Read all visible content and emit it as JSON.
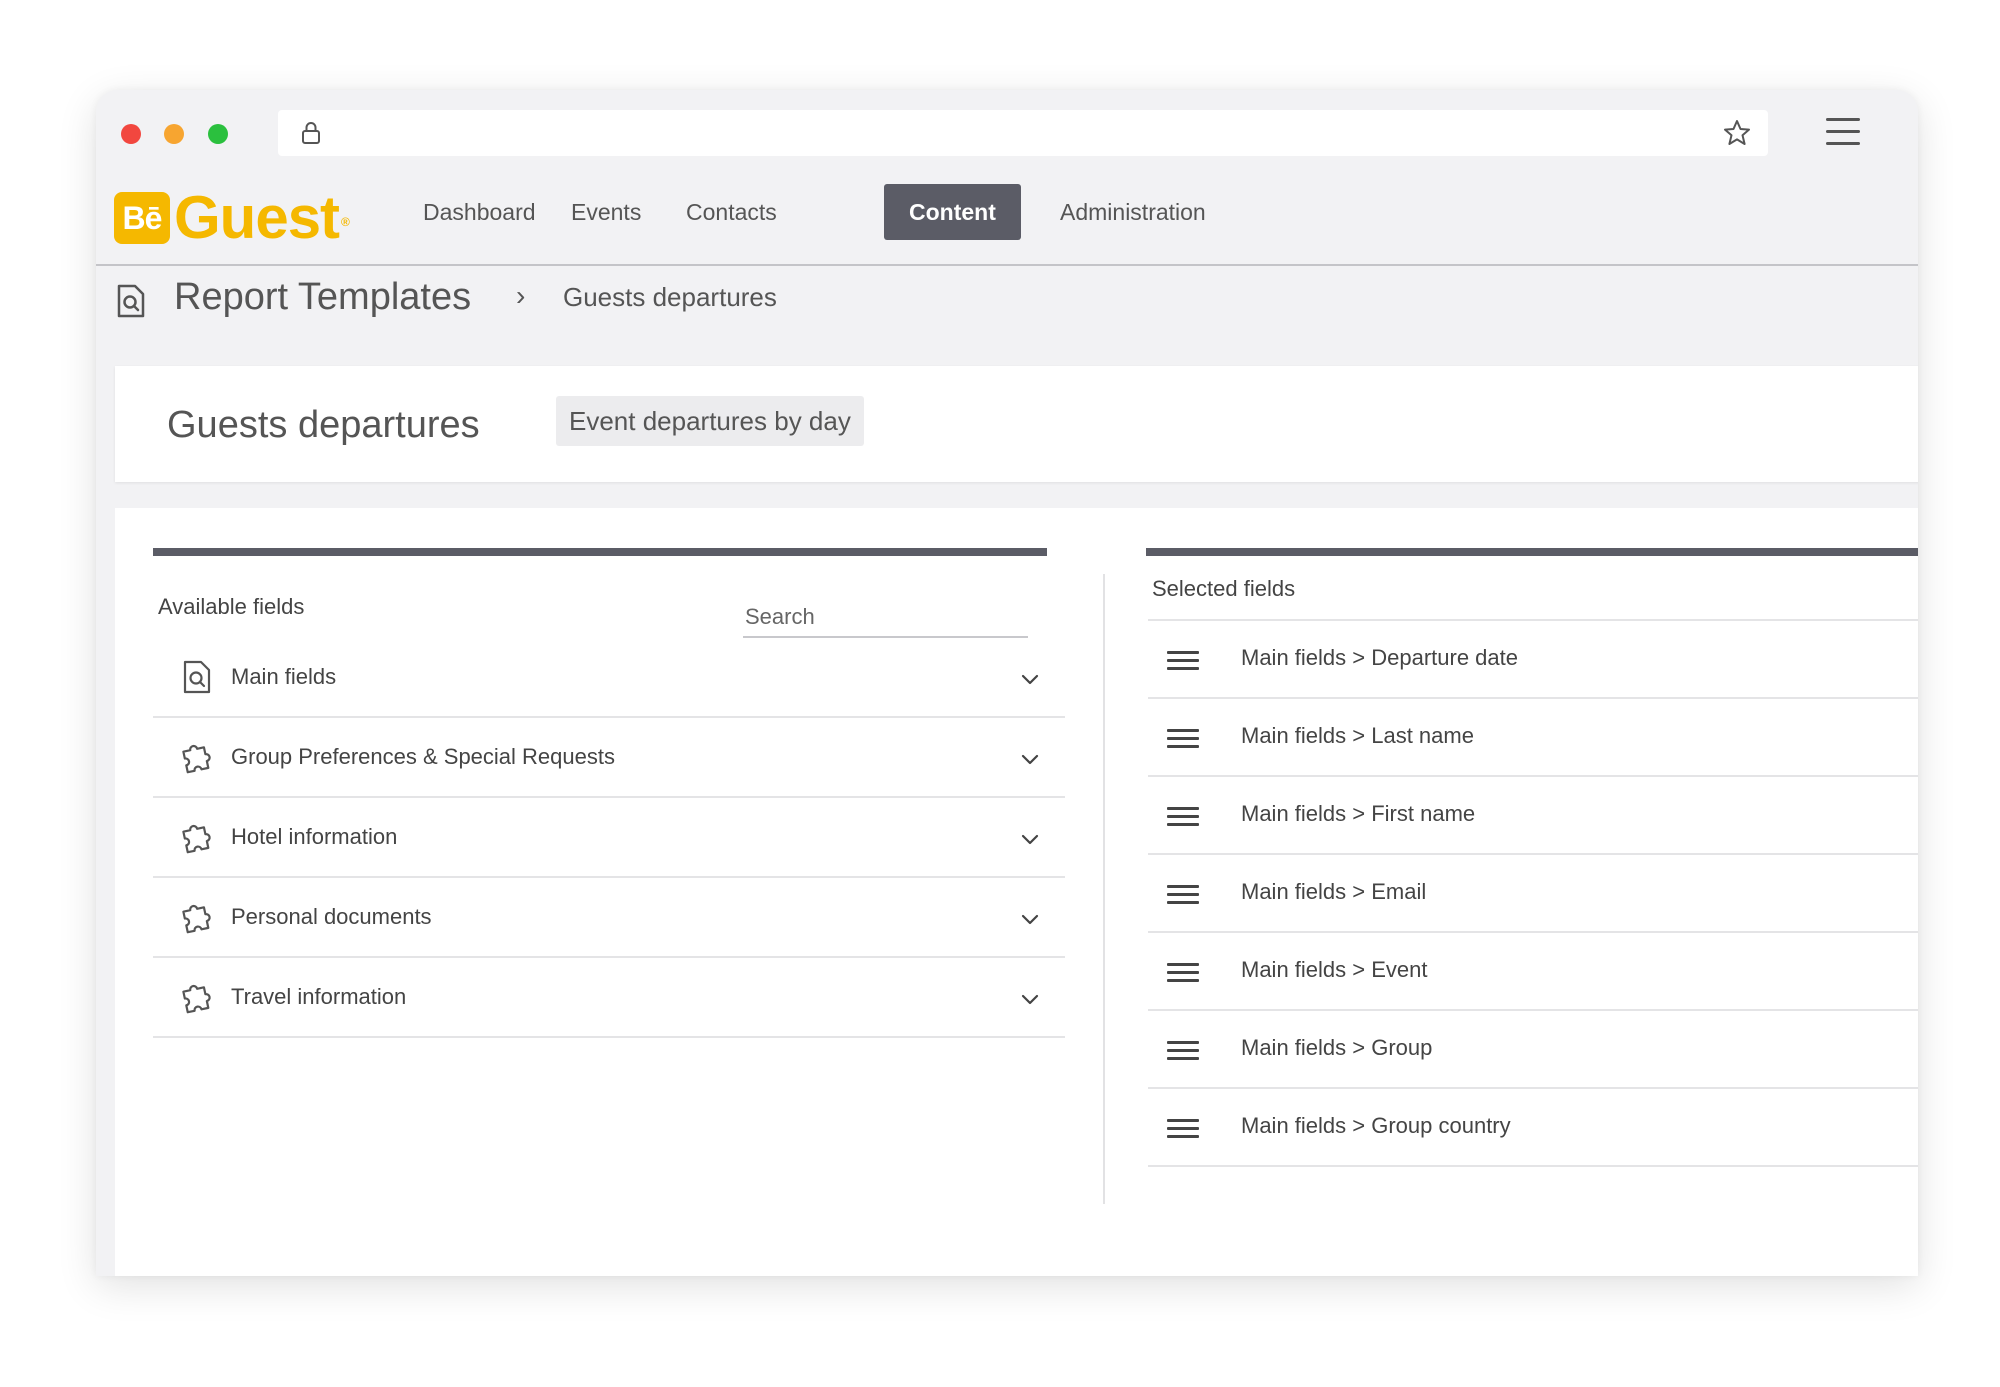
{
  "browser": {
    "icons": {
      "lock": "lock-icon",
      "bookmark": "star-icon",
      "menu": "hamburger-icon"
    }
  },
  "app": {
    "logo": {
      "badge": "Bē",
      "text": "Guest",
      "mark": "®"
    },
    "nav": [
      {
        "label": "Dashboard",
        "active": false
      },
      {
        "label": "Events",
        "active": false
      },
      {
        "label": "Contacts",
        "active": false
      },
      {
        "label": "Content",
        "active": true
      },
      {
        "label": "Administration",
        "active": false
      }
    ]
  },
  "breadcrumb": {
    "root": "Report Templates",
    "separator": "›",
    "current": "Guests departures"
  },
  "page": {
    "title": "Guests departures",
    "tag": "Event departures by day"
  },
  "available": {
    "label": "Available fields",
    "search_placeholder": "Search",
    "search_value": "",
    "groups": [
      {
        "label": "Main fields",
        "icon": "document-search-icon"
      },
      {
        "label": "Group Preferences & Special Requests",
        "icon": "puzzle-icon"
      },
      {
        "label": "Hotel information",
        "icon": "puzzle-icon"
      },
      {
        "label": "Personal documents",
        "icon": "puzzle-icon"
      },
      {
        "label": "Travel information",
        "icon": "puzzle-icon"
      }
    ]
  },
  "selected": {
    "label": "Selected fields",
    "items": [
      "Main fields > Departure date",
      "Main fields > Last name",
      "Main fields > First name",
      "Main fields > Email",
      "Main fields > Event",
      "Main fields > Group",
      "Main fields > Group country"
    ]
  },
  "colors": {
    "brand": "#f5b800",
    "nav_active": "#5b5c66",
    "panel_bar": "#5b5c66"
  }
}
